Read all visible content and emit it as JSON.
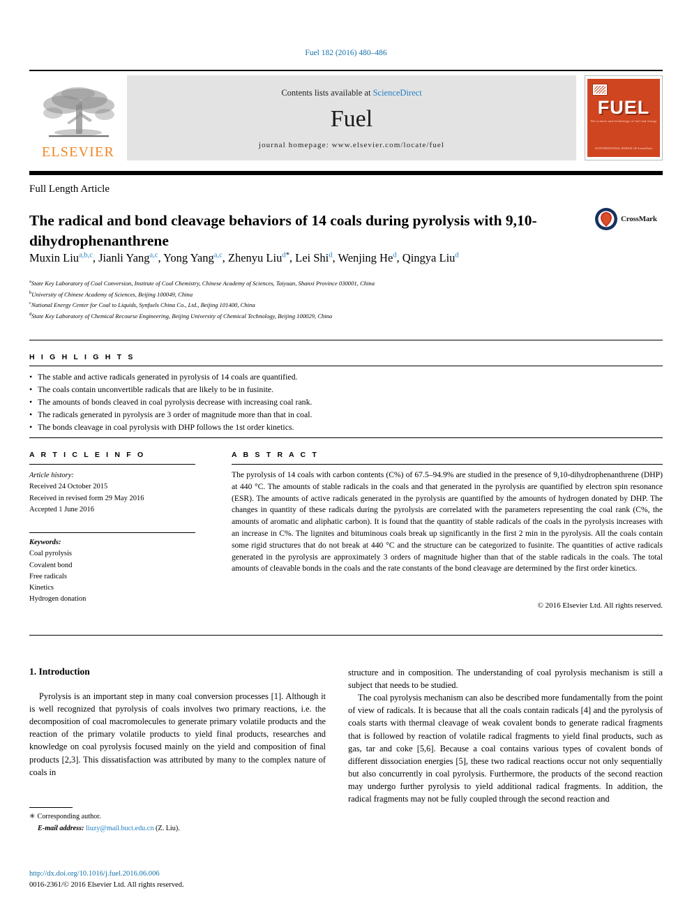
{
  "running_head": "Fuel 182 (2016) 480–486",
  "masthead": {
    "publisher": "ELSEVIER",
    "contents_prefix": "Contents lists available at ",
    "contents_link": "ScienceDirect",
    "journal_name": "Fuel",
    "homepage": "journal homepage: www.elsevier.com/locate/fuel",
    "cover": {
      "title": "FUEL",
      "subtitle": "The science and technology of fuel and energy",
      "footer": "AN INTERNATIONAL JOURNAL OF\nScienceDirect"
    },
    "accent_color": "#f08522",
    "cover_color": "#cf4520",
    "band_color": "#e3e3e3"
  },
  "article_type": "Full Length Article",
  "title": "The radical and bond cleavage behaviors of 14 coals during pyrolysis with 9,10-dihydrophenanthrene",
  "crossmark": {
    "label": "CrossMark"
  },
  "authors": [
    {
      "name": "Muxin Liu",
      "sup": "a,b,c"
    },
    {
      "name": "Jianli Yang",
      "sup": "a,c"
    },
    {
      "name": "Yong Yang",
      "sup": "a,c"
    },
    {
      "name": "Zhenyu Liu",
      "sup": "d",
      "star": "*"
    },
    {
      "name": "Lei Shi",
      "sup": "d"
    },
    {
      "name": "Wenjing He",
      "sup": "d"
    },
    {
      "name": "Qingya Liu",
      "sup": "d"
    }
  ],
  "affiliations": [
    {
      "mark": "a",
      "text": "State Key Laboratory of Coal Conversion, Institute of Coal Chemistry, Chinese Academy of Sciences, Taiyuan, Shanxi Province 030001, China"
    },
    {
      "mark": "b",
      "text": "University of Chinese Academy of Sciences, Beijing 100049, China"
    },
    {
      "mark": "c",
      "text": "National Energy Center for Coal to Liquids, Synfuels China Co., Ltd., Beijing 101400, China"
    },
    {
      "mark": "d",
      "text": "State Key Laboratory of Chemical Recourse Engineering, Beijing University of Chemical Technology, Beijing 100029, China"
    }
  ],
  "sections": {
    "highlights_label": "H I G H L I G H T S",
    "article_info_label": "A R T I C L E  I N F O",
    "abstract_label": "A B S T R A C T"
  },
  "highlights": [
    "The stable and active radicals generated in pyrolysis of 14 coals are quantified.",
    "The coals contain unconvertible radicals that are likely to be in fusinite.",
    "The amounts of bonds cleaved in coal pyrolysis decrease with increasing coal rank.",
    "The radicals generated in pyrolysis are 3 order of magnitude more than that in coal.",
    "The bonds cleavage in coal pyrolysis with DHP follows the 1st order kinetics."
  ],
  "article_history": {
    "heading": "Article history:",
    "lines": [
      "Received 24 October 2015",
      "Received in revised form 29 May 2016",
      "Accepted 1 June 2016"
    ]
  },
  "keywords": {
    "heading": "Keywords:",
    "items": [
      "Coal pyrolysis",
      "Covalent bond",
      "Free radicals",
      "Kinetics",
      "Hydrogen donation"
    ]
  },
  "abstract": "The pyrolysis of 14 coals with carbon contents (C%) of 67.5–94.9% are studied in the presence of 9,10-dihydrophenanthrene (DHP) at 440 °C. The amounts of stable radicals in the coals and that generated in the pyrolysis are quantified by electron spin resonance (ESR). The amounts of active radicals generated in the pyrolysis are quantified by the amounts of hydrogen donated by DHP. The changes in quantity of these radicals during the pyrolysis are correlated with the parameters representing the coal rank (C%, the amounts of aromatic and aliphatic carbon). It is found that the quantity of stable radicals of the coals in the pyrolysis increases with an increase in C%. The lignites and bituminous coals break up significantly in the first 2 min in the pyrolysis. All the coals contain some rigid structures that do not break at 440 °C and the structure can be categorized to fusinite. The quantities of active radicals generated in the pyrolysis are approximately 3 orders of magnitude higher than that of the stable radicals in the coals. The total amounts of cleavable bonds in the coals and the rate constants of the bond cleavage are determined by the first order kinetics.",
  "copyright_line": "© 2016 Elsevier Ltd. All rights reserved.",
  "body": {
    "intro_heading": "1. Introduction",
    "left_p1": "Pyrolysis is an important step in many coal conversion processes [1]. Although it is well recognized that pyrolysis of coals involves two primary reactions, i.e. the decomposition of coal macromolecules to generate primary volatile products and the reaction of the primary volatile products to yield final products, researches and knowledge on coal pyrolysis focused mainly on the yield and composition of final products [2,3]. This dissatisfaction was attributed by many to the complex nature of coals in",
    "right_p1": "structure and in composition. The understanding of coal pyrolysis mechanism is still a subject that needs to be studied.",
    "right_p2": "The coal pyrolysis mechanism can also be described more fundamentally from the point of view of radicals. It is because that all the coals contain radicals [4] and the pyrolysis of coals starts with thermal cleavage of weak covalent bonds to generate radical fragments that is followed by reaction of volatile radical fragments to yield final products, such as gas, tar and coke [5,6]. Because a coal contains various types of covalent bonds of different dissociation energies [5], these two radical reactions occur not only sequentially but also concurrently in coal pyrolysis. Furthermore, the products of the second reaction may undergo further pyrolysis to yield additional radical fragments. In addition, the radical fragments may not be fully coupled through the second reaction and"
  },
  "footnote": {
    "corresponding": "Corresponding author.",
    "email_label": "E-mail address:",
    "email": "liuzy@mail.buct.edu.cn",
    "email_suffix": "(Z. Liu)."
  },
  "footer": {
    "doi": "http://dx.doi.org/10.1016/j.fuel.2016.06.006",
    "issn_line": "0016-2361/© 2016 Elsevier Ltd. All rights reserved."
  }
}
